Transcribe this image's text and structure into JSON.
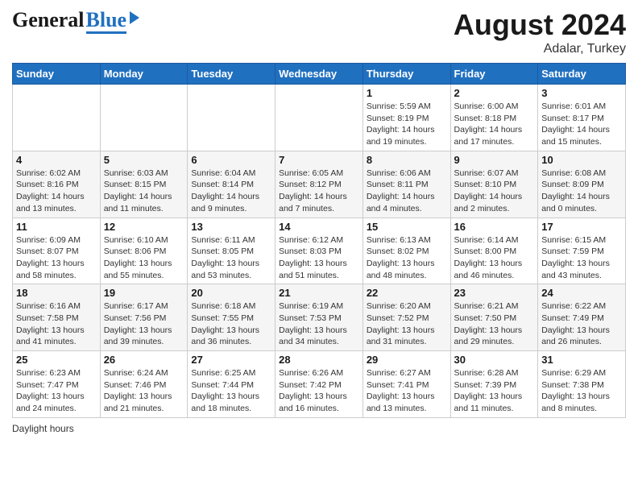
{
  "header": {
    "logo_general": "General",
    "logo_blue": "Blue",
    "title": "August 2024",
    "subtitle": "Adalar, Turkey"
  },
  "calendar": {
    "days_of_week": [
      "Sunday",
      "Monday",
      "Tuesday",
      "Wednesday",
      "Thursday",
      "Friday",
      "Saturday"
    ],
    "weeks": [
      [
        {
          "day": "",
          "info": ""
        },
        {
          "day": "",
          "info": ""
        },
        {
          "day": "",
          "info": ""
        },
        {
          "day": "",
          "info": ""
        },
        {
          "day": "1",
          "info": "Sunrise: 5:59 AM\nSunset: 8:19 PM\nDaylight: 14 hours\nand 19 minutes."
        },
        {
          "day": "2",
          "info": "Sunrise: 6:00 AM\nSunset: 8:18 PM\nDaylight: 14 hours\nand 17 minutes."
        },
        {
          "day": "3",
          "info": "Sunrise: 6:01 AM\nSunset: 8:17 PM\nDaylight: 14 hours\nand 15 minutes."
        }
      ],
      [
        {
          "day": "4",
          "info": "Sunrise: 6:02 AM\nSunset: 8:16 PM\nDaylight: 14 hours\nand 13 minutes."
        },
        {
          "day": "5",
          "info": "Sunrise: 6:03 AM\nSunset: 8:15 PM\nDaylight: 14 hours\nand 11 minutes."
        },
        {
          "day": "6",
          "info": "Sunrise: 6:04 AM\nSunset: 8:14 PM\nDaylight: 14 hours\nand 9 minutes."
        },
        {
          "day": "7",
          "info": "Sunrise: 6:05 AM\nSunset: 8:12 PM\nDaylight: 14 hours\nand 7 minutes."
        },
        {
          "day": "8",
          "info": "Sunrise: 6:06 AM\nSunset: 8:11 PM\nDaylight: 14 hours\nand 4 minutes."
        },
        {
          "day": "9",
          "info": "Sunrise: 6:07 AM\nSunset: 8:10 PM\nDaylight: 14 hours\nand 2 minutes."
        },
        {
          "day": "10",
          "info": "Sunrise: 6:08 AM\nSunset: 8:09 PM\nDaylight: 14 hours\nand 0 minutes."
        }
      ],
      [
        {
          "day": "11",
          "info": "Sunrise: 6:09 AM\nSunset: 8:07 PM\nDaylight: 13 hours\nand 58 minutes."
        },
        {
          "day": "12",
          "info": "Sunrise: 6:10 AM\nSunset: 8:06 PM\nDaylight: 13 hours\nand 55 minutes."
        },
        {
          "day": "13",
          "info": "Sunrise: 6:11 AM\nSunset: 8:05 PM\nDaylight: 13 hours\nand 53 minutes."
        },
        {
          "day": "14",
          "info": "Sunrise: 6:12 AM\nSunset: 8:03 PM\nDaylight: 13 hours\nand 51 minutes."
        },
        {
          "day": "15",
          "info": "Sunrise: 6:13 AM\nSunset: 8:02 PM\nDaylight: 13 hours\nand 48 minutes."
        },
        {
          "day": "16",
          "info": "Sunrise: 6:14 AM\nSunset: 8:00 PM\nDaylight: 13 hours\nand 46 minutes."
        },
        {
          "day": "17",
          "info": "Sunrise: 6:15 AM\nSunset: 7:59 PM\nDaylight: 13 hours\nand 43 minutes."
        }
      ],
      [
        {
          "day": "18",
          "info": "Sunrise: 6:16 AM\nSunset: 7:58 PM\nDaylight: 13 hours\nand 41 minutes."
        },
        {
          "day": "19",
          "info": "Sunrise: 6:17 AM\nSunset: 7:56 PM\nDaylight: 13 hours\nand 39 minutes."
        },
        {
          "day": "20",
          "info": "Sunrise: 6:18 AM\nSunset: 7:55 PM\nDaylight: 13 hours\nand 36 minutes."
        },
        {
          "day": "21",
          "info": "Sunrise: 6:19 AM\nSunset: 7:53 PM\nDaylight: 13 hours\nand 34 minutes."
        },
        {
          "day": "22",
          "info": "Sunrise: 6:20 AM\nSunset: 7:52 PM\nDaylight: 13 hours\nand 31 minutes."
        },
        {
          "day": "23",
          "info": "Sunrise: 6:21 AM\nSunset: 7:50 PM\nDaylight: 13 hours\nand 29 minutes."
        },
        {
          "day": "24",
          "info": "Sunrise: 6:22 AM\nSunset: 7:49 PM\nDaylight: 13 hours\nand 26 minutes."
        }
      ],
      [
        {
          "day": "25",
          "info": "Sunrise: 6:23 AM\nSunset: 7:47 PM\nDaylight: 13 hours\nand 24 minutes."
        },
        {
          "day": "26",
          "info": "Sunrise: 6:24 AM\nSunset: 7:46 PM\nDaylight: 13 hours\nand 21 minutes."
        },
        {
          "day": "27",
          "info": "Sunrise: 6:25 AM\nSunset: 7:44 PM\nDaylight: 13 hours\nand 18 minutes."
        },
        {
          "day": "28",
          "info": "Sunrise: 6:26 AM\nSunset: 7:42 PM\nDaylight: 13 hours\nand 16 minutes."
        },
        {
          "day": "29",
          "info": "Sunrise: 6:27 AM\nSunset: 7:41 PM\nDaylight: 13 hours\nand 13 minutes."
        },
        {
          "day": "30",
          "info": "Sunrise: 6:28 AM\nSunset: 7:39 PM\nDaylight: 13 hours\nand 11 minutes."
        },
        {
          "day": "31",
          "info": "Sunrise: 6:29 AM\nSunset: 7:38 PM\nDaylight: 13 hours\nand 8 minutes."
        }
      ]
    ]
  },
  "footer": {
    "daylight_label": "Daylight hours"
  }
}
